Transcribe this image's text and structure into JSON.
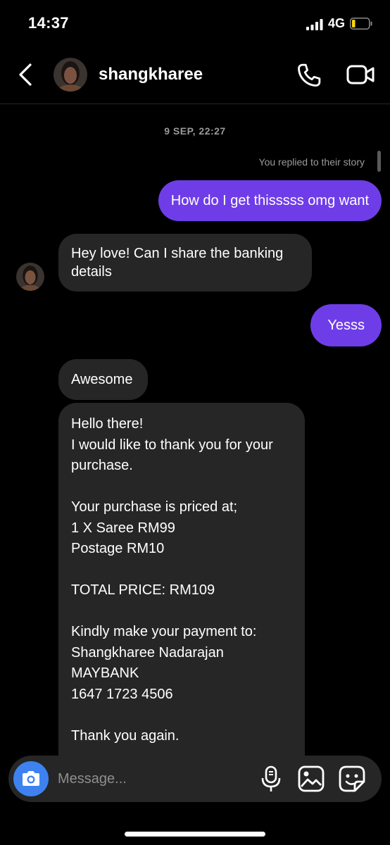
{
  "status_bar": {
    "time": "14:37",
    "network": "4G",
    "battery_level": 0.2
  },
  "header": {
    "username": "shangkharee"
  },
  "chat": {
    "timestamp": "9 SEP, 22:27",
    "reply_note": "You replied to their story",
    "messages": [
      {
        "from": "me",
        "text": "How do I get thisssss omg want"
      },
      {
        "from": "them",
        "text": "Hey love! Can I share the banking details"
      },
      {
        "from": "me",
        "text": "Yesss"
      },
      {
        "from": "them",
        "text": "Awesome"
      },
      {
        "from": "them",
        "text": "Hello there!\nI would like to thank you for your purchase.\n\nYour purchase is priced at;\n1 X Saree RM99\nPostage RM10\n\nTOTAL PRICE: RM109\n\nKindly make your payment to:\nShangkharee Nadarajan\nMAYBANK\n1647 1723 4506\n\nThank you again."
      }
    ]
  },
  "composer": {
    "placeholder": "Message..."
  },
  "colors": {
    "outgoing_bubble": "#6f3de8",
    "incoming_bubble": "#262626",
    "camera_button": "#3d82f0"
  },
  "icons": [
    "back-icon",
    "phone-icon",
    "video-icon",
    "camera-icon",
    "microphone-icon",
    "gallery-icon",
    "sticker-icon"
  ]
}
